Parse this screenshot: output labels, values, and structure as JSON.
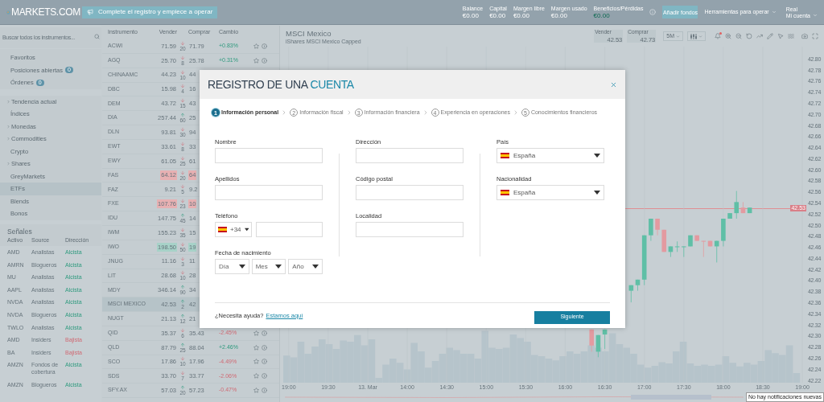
{
  "top_bar": {
    "logo": "MARKETS.COM",
    "register_button": "Complete el registro y empiece a operar",
    "stats": [
      {
        "label": "Balance",
        "value": "€0.00",
        "gain": false
      },
      {
        "label": "Capital",
        "value": "€0.00",
        "gain": false
      },
      {
        "label": "Margen libre",
        "value": "€0.00",
        "gain": false
      },
      {
        "label": "Margen usado",
        "value": "€0.00",
        "gain": false
      },
      {
        "label": "Beneficios/Pérdidas",
        "value": "€0.00",
        "gain": true
      }
    ],
    "add_funds_button": "Añadir fondos",
    "tools_menu": "Herramientas para operar",
    "account": {
      "mode": "Real",
      "label": "Mi cuenta"
    }
  },
  "sidebar": {
    "search": {
      "placeholder": "Buscar todos los instrumentos..."
    },
    "items": [
      {
        "label": "Favoritos",
        "expandable": false,
        "selected": false
      },
      {
        "label": "Posiciones abiertas",
        "badge": "0",
        "expandable": false,
        "selected": false
      },
      {
        "label": "Órdenes",
        "badge": "0",
        "expandable": false,
        "selected": false
      },
      {
        "label": "Tendencia actual",
        "expandable": true,
        "selected": false,
        "divider_before": true
      },
      {
        "label": "Índices",
        "expandable": false,
        "selected": false
      },
      {
        "label": "Monedas",
        "expandable": true,
        "selected": false
      },
      {
        "label": "Commodities",
        "expandable": true,
        "selected": false
      },
      {
        "label": "Crypto",
        "expandable": false,
        "selected": false
      },
      {
        "label": "Shares",
        "expandable": true,
        "selected": false
      },
      {
        "label": "GreyMarkets",
        "expandable": false,
        "selected": false
      },
      {
        "label": "ETFs",
        "expandable": false,
        "selected": true
      },
      {
        "label": "Blends",
        "expandable": false,
        "selected": false
      },
      {
        "label": "Bonos",
        "expandable": false,
        "selected": false
      }
    ],
    "signals": {
      "title": "Señales",
      "columns": [
        "Activo",
        "Source",
        "Dirección"
      ],
      "rows": [
        {
          "asset": "AMD",
          "source": "Analistas",
          "direction": "Alcista",
          "bullish": true
        },
        {
          "asset": "AMRN",
          "source": "Blogueros",
          "direction": "Alcista",
          "bullish": true
        },
        {
          "asset": "MU",
          "source": "Analistas",
          "direction": "Alcista",
          "bullish": true
        },
        {
          "asset": "AAPL",
          "source": "Analistas",
          "direction": "Alcista",
          "bullish": true
        },
        {
          "asset": "NVDA",
          "source": "Analistas",
          "direction": "Alcista",
          "bullish": true
        },
        {
          "asset": "NVDA",
          "source": "Blogueros",
          "direction": "Alcista",
          "bullish": true
        },
        {
          "asset": "TWLO",
          "source": "Analistas",
          "direction": "Alcista",
          "bullish": true
        },
        {
          "asset": "AMD",
          "source": "Insiders",
          "direction": "Bajista",
          "bullish": false
        },
        {
          "asset": "BA",
          "source": "Insiders",
          "direction": "Bajista",
          "bullish": false
        },
        {
          "asset": "AMZN",
          "source": "Fondos de cobertura",
          "direction": "Alcista",
          "bullish": true
        },
        {
          "asset": "AMZN",
          "source": "Blogueros",
          "direction": "Alcista",
          "bullish": true
        }
      ]
    }
  },
  "instruments": {
    "columns": [
      "Instrumento",
      "Vender",
      "Comprar",
      "Cambio"
    ],
    "rows": [
      {
        "name": "ACWI",
        "sell": "71.59",
        "rising": false,
        "spread": "20",
        "buy": "71.79",
        "change": "+0.83%",
        "gain": true,
        "selected": false
      },
      {
        "name": "AGQ",
        "sell": "25.70",
        "rising": false,
        "spread": "8",
        "buy": "25.78",
        "change": "+0.31%",
        "gain": true,
        "selected": false
      },
      {
        "name": "CHINAAMC",
        "sell": "44.23",
        "rising": false,
        "spread": "10",
        "buy": "44",
        "selected": false
      },
      {
        "name": "DBC",
        "sell": "15.98",
        "rising": false,
        "spread": "4",
        "buy": "16",
        "selected": false
      },
      {
        "name": "DEM",
        "sell": "43.72",
        "rising": false,
        "spread": "15",
        "buy": "43",
        "selected": false
      },
      {
        "name": "DIA",
        "sell": "257.44",
        "rising": true,
        "spread": "60",
        "buy": "25",
        "selected": false
      },
      {
        "name": "DLN",
        "sell": "93.81",
        "rising": false,
        "spread": "30",
        "buy": "94",
        "selected": false
      },
      {
        "name": "EWT",
        "sell": "33.61",
        "rising": false,
        "spread": "8",
        "buy": "33",
        "selected": false
      },
      {
        "name": "EWY",
        "sell": "61.05",
        "rising": false,
        "spread": "25",
        "buy": "61",
        "selected": false
      },
      {
        "name": "FAS",
        "sell": "64.12",
        "rising": false,
        "spread": "20",
        "buy": "64",
        "color": "#e7b0b2",
        "selected": false
      },
      {
        "name": "FAZ",
        "sell": "9.21",
        "rising": false,
        "spread": "5",
        "buy": "9.2",
        "selected": false
      },
      {
        "name": "FXE",
        "sell": "107.76",
        "rising": false,
        "spread": "23",
        "buy": "10",
        "color": "#e7b0b2",
        "selected": false
      },
      {
        "name": "IDU",
        "sell": "147.75",
        "rising": true,
        "spread": "45",
        "buy": "14",
        "selected": false
      },
      {
        "name": "IWM",
        "sell": "155.23",
        "rising": false,
        "spread": "35",
        "buy": "15",
        "selected": false
      },
      {
        "name": "IWO",
        "sell": "198.50",
        "rising": false,
        "spread": "50",
        "buy": "19",
        "color": "#a7d2c8",
        "selected": false
      },
      {
        "name": "JNUG",
        "sell": "11.16",
        "rising": false,
        "spread": "3",
        "buy": "11",
        "selected": false
      },
      {
        "name": "LIT",
        "sell": "28.68",
        "rising": false,
        "spread": "10",
        "buy": "28",
        "selected": false
      },
      {
        "name": "MDY",
        "sell": "346.14",
        "rising": true,
        "spread": "90",
        "buy": "34",
        "selected": false
      },
      {
        "name": "MSCI MEXICO",
        "sell": "42.53",
        "rising": true,
        "spread": "2",
        "buy": "42",
        "selected": true
      },
      {
        "name": "NUGT",
        "sell": "21.13",
        "rising": true,
        "spread": "12",
        "buy": "21",
        "selected": false
      },
      {
        "name": "QID",
        "sell": "35.37",
        "rising": false,
        "spread": "6",
        "buy": "35.43",
        "change": "-2.45%",
        "gain": false,
        "selected": false
      },
      {
        "name": "QLD",
        "sell": "87.79",
        "rising": true,
        "spread": "25",
        "buy": "88.04",
        "change": "+2.46%",
        "gain": true,
        "selected": false
      },
      {
        "name": "SCO",
        "sell": "17.86",
        "rising": false,
        "spread": "10",
        "buy": "17.96",
        "change": "-4.49%",
        "gain": false,
        "selected": false
      },
      {
        "name": "SDS",
        "sell": "33.70",
        "rising": false,
        "spread": "7",
        "buy": "33.77",
        "change": "-2.06%",
        "gain": false,
        "selected": false
      },
      {
        "name": "SFY.AX",
        "sell": "57.03",
        "rising": true,
        "spread": "20",
        "buy": "57.23",
        "change": "-0.47%",
        "gain": false,
        "selected": false
      }
    ]
  },
  "chart": {
    "title": "MSCI Mexico",
    "subtitle": "iShares MSCI Mexico Capped",
    "sell": {
      "label": "Vender",
      "value": "42.53"
    },
    "buy": {
      "label": "Comprar",
      "value": "42.73"
    },
    "interval": "5M",
    "current_price": "42.53",
    "chart_data": {
      "type": "candlestick",
      "grid": true,
      "ylim": [
        42.215,
        42.8215
      ],
      "categories": [
        "19:00",
        null,
        null,
        null,
        null,
        null,
        "19:30",
        null,
        null,
        null,
        null,
        null,
        "13. Mar",
        null,
        null,
        null,
        null,
        null,
        "14:00",
        null,
        null,
        null,
        null,
        null,
        "14:30",
        null,
        null,
        null,
        null,
        null,
        "15:00",
        null,
        null,
        null,
        null,
        null,
        "15:30",
        null,
        null,
        null,
        null,
        null,
        "16:00",
        null,
        null,
        null,
        null,
        null,
        "16:30",
        null,
        null,
        null,
        null,
        null,
        "17:00",
        null,
        null,
        null,
        null,
        null,
        "17:30",
        null,
        null,
        null,
        null,
        null,
        "18:00",
        null,
        null,
        null,
        null,
        null,
        "18:30",
        null,
        null,
        null,
        null,
        null,
        "19:00"
      ],
      "ohlc": [
        null,
        null,
        null,
        null,
        null,
        null,
        null,
        null,
        null,
        null,
        null,
        null,
        null,
        null,
        null,
        null,
        null,
        null,
        null,
        null,
        null,
        null,
        null,
        null,
        null,
        null,
        null,
        null,
        null,
        null,
        null,
        null,
        null,
        null,
        null,
        null,
        null,
        null,
        null,
        null,
        null,
        null,
        null,
        null,
        null,
        null,
        [
          42.311,
          42.311,
          42.271,
          42.282
        ],
        [
          42.271,
          42.301,
          42.261,
          42.301
        ],
        [
          42.302,
          42.311,
          42.276,
          42.311
        ],
        null,
        null,
        null,
        [
          42.381,
          42.391,
          42.36,
          42.391
        ],
        [
          42.391,
          42.401,
          42.381,
          42.401
        ],
        [
          42.401,
          42.481,
          42.391,
          42.481
        ],
        [
          42.481,
          42.511,
          42.471,
          42.511
        ],
        [
          42.511,
          42.511,
          42.481,
          42.491
        ],
        [
          42.491,
          42.491,
          42.451,
          42.451
        ],
        [
          42.451,
          42.461,
          42.442,
          42.461
        ],
        [
          42.461,
          42.47,
          42.451,
          42.461
        ],
        [
          42.461,
          42.461,
          42.442,
          42.461
        ],
        [
          42.461,
          42.481,
          42.461,
          42.481
        ],
        [
          42.481,
          42.481,
          42.471,
          42.471
        ],
        [
          42.471,
          42.471,
          42.442,
          42.47
        ],
        [
          42.471,
          42.471,
          42.461,
          42.461
        ],
        [
          42.461,
          42.471,
          42.432,
          42.471
        ],
        [
          42.471,
          42.511,
          42.461,
          42.511
        ],
        [
          42.511,
          42.521,
          42.511,
          42.521
        ],
        [
          42.521,
          42.561,
          42.511,
          42.541
        ],
        [
          42.531,
          42.541,
          42.521,
          42.521
        ],
        [
          42.521,
          42.531,
          42.521,
          42.531
        ],
        null,
        null,
        null,
        null,
        null,
        null,
        null,
        null
      ],
      "yticks": [
        {
          "value": 42.8,
          "label": "42.80"
        },
        {
          "value": 42.78,
          "label": "42.78"
        },
        {
          "value": 42.76,
          "label": "42.76"
        },
        {
          "value": 42.74,
          "label": "42.74"
        },
        {
          "value": 42.72,
          "label": "42.72"
        },
        {
          "value": 42.7,
          "label": "42.70"
        },
        {
          "value": 42.68,
          "label": "42.68"
        },
        {
          "value": 42.66,
          "label": "42.66"
        },
        {
          "value": 42.64,
          "label": "42.64"
        },
        {
          "value": 42.62,
          "label": "42.62"
        },
        {
          "value": 42.6,
          "label": "42.60"
        },
        {
          "value": 42.58,
          "label": "42.58"
        },
        {
          "value": 42.56,
          "label": "42.56"
        },
        {
          "value": 42.54,
          "label": "42.54"
        },
        {
          "value": 42.52,
          "label": "42.52"
        },
        {
          "value": 42.5,
          "label": "42.50"
        },
        {
          "value": 42.48,
          "label": "42.48"
        },
        {
          "value": 42.46,
          "label": "42.46"
        },
        {
          "value": 42.44,
          "label": "42.44"
        },
        {
          "value": 42.42,
          "label": "42.42"
        },
        {
          "value": 42.4,
          "label": "42.40"
        },
        {
          "value": 42.38,
          "label": "42.38"
        },
        {
          "value": 42.36,
          "label": "42.36"
        },
        {
          "value": 42.34,
          "label": "42.34"
        },
        {
          "value": 42.32,
          "label": "42.32"
        },
        {
          "value": 42.3,
          "label": "42.30"
        },
        {
          "value": 42.28,
          "label": "42.28"
        },
        {
          "value": 42.26,
          "label": "42.26"
        },
        {
          "value": 42.24,
          "label": "42.24"
        },
        {
          "value": 42.22,
          "label": "42.22"
        }
      ]
    }
  },
  "modal": {
    "title": "REGISTRO DE UNA",
    "title_highlight": "CUENTA",
    "steps": [
      {
        "number": "1",
        "label": "Información personal",
        "selected": true
      },
      {
        "number": "2",
        "label": "Información fiscal",
        "selected": false
      },
      {
        "number": "3",
        "label": "Información financiera",
        "selected": false
      },
      {
        "number": "4",
        "label": "Experiencia en operaciones",
        "selected": false
      },
      {
        "number": "5",
        "label": "Conocimientos financieros",
        "selected": false
      }
    ],
    "columns": [
      [
        {
          "label": "Nombre",
          "kind": "text"
        },
        {
          "label": "Apellidos",
          "kind": "text"
        },
        {
          "label": "Teléfono",
          "kind": "phone",
          "code": "+34"
        },
        {
          "label": "Fecha de nacimiento",
          "kind": "date",
          "parts": [
            "Día",
            "Mes",
            "Año"
          ]
        }
      ],
      [
        {
          "label": "Dirección",
          "kind": "text"
        },
        {
          "label": "Código postal",
          "kind": "text"
        },
        {
          "label": "Localidad",
          "kind": "text"
        }
      ],
      [
        {
          "label": "País",
          "kind": "country",
          "value": "España"
        },
        {
          "label": "Nacionalidad",
          "kind": "country",
          "value": "España"
        }
      ]
    ],
    "help_text": "¿Necesita ayuda?",
    "help_link": "Estamos aquí",
    "next_button": "Siguiente"
  },
  "notification": "No hay notificaciones nuevas"
}
